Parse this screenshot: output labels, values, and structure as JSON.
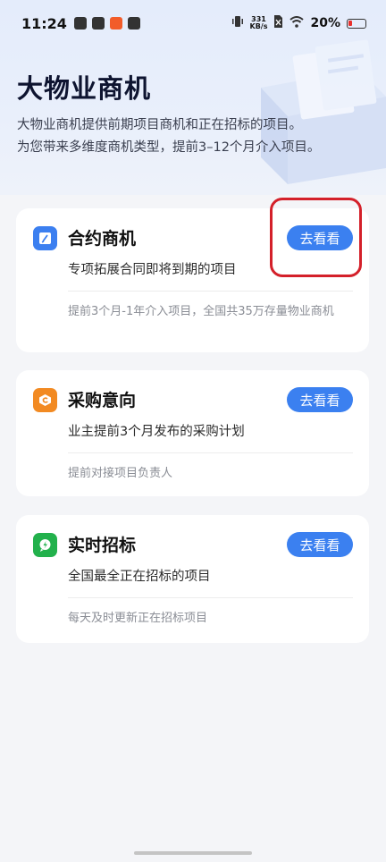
{
  "status_bar": {
    "time": "11:24",
    "net_speed_value": "331",
    "net_speed_unit": "KB/s",
    "battery_percent": "20%"
  },
  "hero": {
    "title": "大物业商机",
    "desc_line1": "大物业商机提供前期项目商机和正在招标的项目。",
    "desc_line2": "为您带来多维度商机类型，提前3–12个月介入项目。"
  },
  "cards": [
    {
      "icon": "contract-icon",
      "icon_color": "#3b7ff0",
      "title": "合约商机",
      "button": "去看看",
      "subtitle": "专项拓展合同即将到期的项目",
      "note": "提前3个月-1年介入项目，全国共35万存量物业商机"
    },
    {
      "icon": "procurement-icon",
      "icon_color": "#f28a22",
      "title": "采购意向",
      "button": "去看看",
      "subtitle": "业主提前3个月发布的采购计划",
      "note": "提前对接项目负责人"
    },
    {
      "icon": "bidding-icon",
      "icon_color": "#22b14c",
      "title": "实时招标",
      "button": "去看看",
      "subtitle": "全国最全正在招标的项目",
      "note": "每天及时更新正在招标项目"
    }
  ]
}
